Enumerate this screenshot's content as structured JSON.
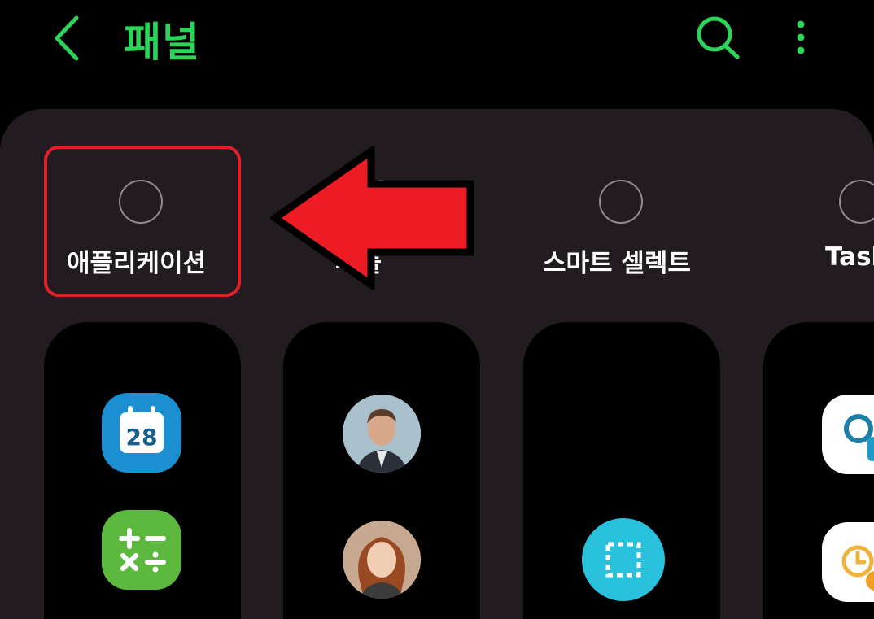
{
  "header": {
    "title": "패널"
  },
  "panel_options": [
    {
      "label": "애플리케이션",
      "selected": false
    },
    {
      "label": "피플",
      "selected": false,
      "partially_hidden": true,
      "visible_fragment": "플"
    },
    {
      "label": "스마트 셀렉트",
      "selected": false
    },
    {
      "label": "Tasks",
      "selected": false,
      "partially_hidden": true,
      "visible_fragment": "Tas"
    }
  ],
  "cards": {
    "apps": [
      {
        "icon": "calendar-icon",
        "text": "28",
        "color": "#1b8fd0"
      },
      {
        "icon": "calculator-icon",
        "text": "+ − × ÷",
        "color": "#5db83e"
      }
    ],
    "people": [
      {
        "icon": "contact-avatar-male"
      },
      {
        "icon": "contact-avatar-female"
      }
    ],
    "smart_select": [
      {
        "icon": "smart-select-icon",
        "color": "#29c1dc"
      }
    ],
    "tasks": [
      {
        "icon": "task-search-icon"
      },
      {
        "icon": "task-clock-icon"
      }
    ]
  },
  "colors": {
    "accent": "#2ed35a",
    "sheet": "#221c21",
    "highlight": "#e0202a",
    "arrow": "#ed1c24"
  }
}
